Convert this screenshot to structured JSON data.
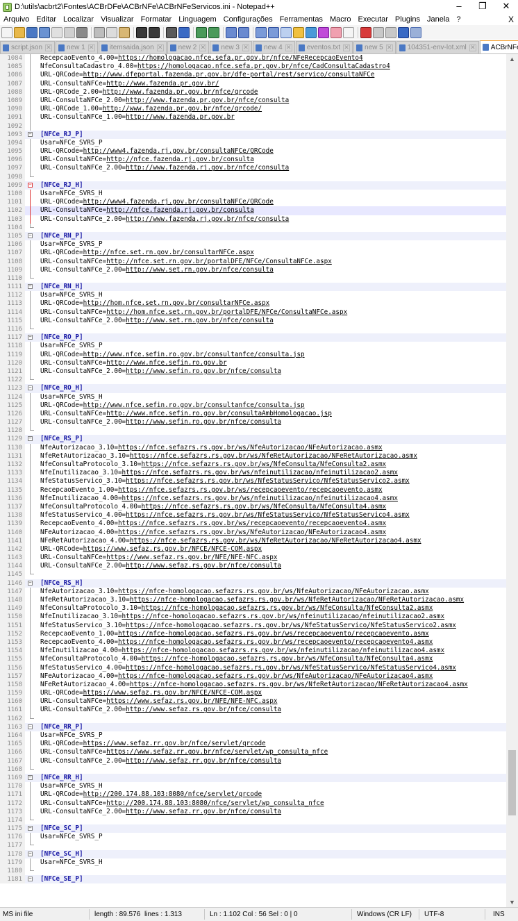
{
  "window": {
    "title": "D:\\utils\\acbrt2\\Fontes\\ACBrDFe\\ACBrNFe\\ACBrNFeServicos.ini - Notepad++",
    "minimize": "–",
    "maximize": "❐",
    "close": "✕"
  },
  "menu": {
    "items": [
      "Arquivo",
      "Editar",
      "Localizar",
      "Visualizar",
      "Formatar",
      "Linguagem",
      "Configurações",
      "Ferramentas",
      "Macro",
      "Executar",
      "Plugins",
      "Janela",
      "?"
    ],
    "close_doc": "X"
  },
  "tabs": [
    {
      "label": "script.json",
      "active": false
    },
    {
      "label": "new 1",
      "active": false
    },
    {
      "label": "itemsaida.json",
      "active": false
    },
    {
      "label": "new 2",
      "active": false
    },
    {
      "label": "new 3",
      "active": false
    },
    {
      "label": "new 4",
      "active": false
    },
    {
      "label": "eventos.txt",
      "active": false
    },
    {
      "label": "new 5",
      "active": false
    },
    {
      "label": "104351-env-lot.xml",
      "active": false
    },
    {
      "label": "ACBrNFeServicos.ini",
      "active": true
    }
  ],
  "editor": {
    "lines": [
      {
        "n": "1084",
        "t": "RecepcaoEvento_4.00=https://homologacao.nfce.sefa.pr.gov.br/nfce/NFeRecepcaoEvento4"
      },
      {
        "n": "1085",
        "t": "NfeConsultaCadastro_4.00=https://homologacao.nfce.sefa.pr.gov.br/nfce/CadConsultaCadastro4"
      },
      {
        "n": "1086",
        "t": "URL-QRCode=http://www.dfeportal.fazenda.pr.gov.br/dfe-portal/rest/servico/consultaNFCe"
      },
      {
        "n": "1087",
        "t": "URL-ConsultaNFCe=http://www.fazenda.pr.gov.br/"
      },
      {
        "n": "1088",
        "t": "URL-QRCode_2.00=http://www.fazenda.pr.gov.br/nfce/qrcode"
      },
      {
        "n": "1089",
        "t": "URL-ConsultaNFCe_2.00=http://www.fazenda.pr.gov.br/nfce/consulta"
      },
      {
        "n": "1090",
        "t": "URL-QRCode_1.00=http://www.fazenda.pr.gov.br/nfce/qrcode/"
      },
      {
        "n": "1091",
        "t": "URL-ConsultaNFCe_1.00=http://www.fazenda.pr.gov.br"
      },
      {
        "n": "1092",
        "t": ""
      },
      {
        "n": "1093",
        "t": "[NFCe_RJ_P]"
      },
      {
        "n": "1094",
        "t": "Usar=NFCe_SVRS_P"
      },
      {
        "n": "1095",
        "t": "URL-QRCode=http://www4.fazenda.rj.gov.br/consultaNFCe/QRCode"
      },
      {
        "n": "1096",
        "t": "URL-ConsultaNFCe=http://nfce.fazenda.rj.gov.br/consulta"
      },
      {
        "n": "1097",
        "t": "URL-ConsultaNFCe_2.00=http://www.fazenda.rj.gov.br/nfce/consulta"
      },
      {
        "n": "1098",
        "t": ""
      },
      {
        "n": "1099",
        "t": "[NFCe_RJ_H]"
      },
      {
        "n": "1100",
        "t": "Usar=NFCe_SVRS_H"
      },
      {
        "n": "1101",
        "t": "URL-QRCode=http://www4.fazenda.rj.gov.br/consultaNFCe/QRCode"
      },
      {
        "n": "1102",
        "t": "URL-ConsultaNFCe=http://nfce.fazenda.rj.gov.br/consulta"
      },
      {
        "n": "1103",
        "t": "URL-ConsultaNFCe_2.00=http://www.fazenda.rj.gov.br/nfce/consulta"
      },
      {
        "n": "1104",
        "t": ""
      },
      {
        "n": "1105",
        "t": "[NFCe_RN_P]"
      },
      {
        "n": "1106",
        "t": "Usar=NFCe_SVRS_P"
      },
      {
        "n": "1107",
        "t": "URL-QRCode=http://nfce.set.rn.gov.br/consultarNFCe.aspx"
      },
      {
        "n": "1108",
        "t": "URL-ConsultaNFCe=http://nfce.set.rn.gov.br/portalDFE/NFCe/ConsultaNFCe.aspx"
      },
      {
        "n": "1109",
        "t": "URL-ConsultaNFCe_2.00=http://www.set.rn.gov.br/nfce/consulta"
      },
      {
        "n": "1110",
        "t": ""
      },
      {
        "n": "1111",
        "t": "[NFCe_RN_H]"
      },
      {
        "n": "1112",
        "t": "Usar=NFCe_SVRS_H"
      },
      {
        "n": "1113",
        "t": "URL-QRCode=http://hom.nfce.set.rn.gov.br/consultarNFCe.aspx"
      },
      {
        "n": "1114",
        "t": "URL-ConsultaNFCe=http://hom.nfce.set.rn.gov.br/portalDFE/NFCe/ConsultaNFCe.aspx"
      },
      {
        "n": "1115",
        "t": "URL-ConsultaNFCe_2.00=http://www.set.rn.gov.br/nfce/consulta"
      },
      {
        "n": "1116",
        "t": ""
      },
      {
        "n": "1117",
        "t": "[NFCe_RO_P]"
      },
      {
        "n": "1118",
        "t": "Usar=NFCe_SVRS_P"
      },
      {
        "n": "1119",
        "t": "URL-QRCode=http://www.nfce.sefin.ro.gov.br/consultanfce/consulta.jsp"
      },
      {
        "n": "1120",
        "t": "URL-ConsultaNFCe=http://www.nfce.sefin.ro.gov.br"
      },
      {
        "n": "1121",
        "t": "URL-ConsultaNFCe_2.00=http://www.sefin.ro.gov.br/nfce/consulta"
      },
      {
        "n": "1122",
        "t": ""
      },
      {
        "n": "1123",
        "t": "[NFCe_RO_H]"
      },
      {
        "n": "1124",
        "t": "Usar=NFCe_SVRS_H"
      },
      {
        "n": "1125",
        "t": "URL-QRCode=http://www.nfce.sefin.ro.gov.br/consultanfce/consulta.jsp"
      },
      {
        "n": "1126",
        "t": "URL-ConsultaNFCe=http://www.nfce.sefin.ro.gov.br/consultaAmbHomologacao.jsp"
      },
      {
        "n": "1127",
        "t": "URL-ConsultaNFCe_2.00=http://www.sefin.ro.gov.br/nfce/consulta"
      },
      {
        "n": "1128",
        "t": ""
      },
      {
        "n": "1129",
        "t": "[NFCe_RS_P]"
      },
      {
        "n": "1130",
        "t": "NfeAutorizacao_3.10=https://nfce.sefazrs.rs.gov.br/ws/NfeAutorizacao/NFeAutorizacao.asmx"
      },
      {
        "n": "1131",
        "t": "NfeRetAutorizacao_3.10=https://nfce.sefazrs.rs.gov.br/ws/NfeRetAutorizacao/NFeRetAutorizacao.asmx"
      },
      {
        "n": "1132",
        "t": "NfeConsultaProtocolo_3.10=https://nfce.sefazrs.rs.gov.br/ws/NfeConsulta/NfeConsulta2.asmx"
      },
      {
        "n": "1133",
        "t": "NfeInutilizacao_3.10=https://nfce.sefazrs.rs.gov.br/ws/nfeinutilizacao/nfeinutilizacao2.asmx"
      },
      {
        "n": "1134",
        "t": "NfeStatusServico_3.10=https://nfce.sefazrs.rs.gov.br/ws/NfeStatusServico/NfeStatusServico2.asmx"
      },
      {
        "n": "1135",
        "t": "RecepcaoEvento_1.00=https://nfce.sefazrs.rs.gov.br/ws/recepcaoevento/recepcaoevento.asmx"
      },
      {
        "n": "1136",
        "t": "NfeInutilizacao_4.00=https://nfce.sefazrs.rs.gov.br/ws/nfeinutilizacao/nfeinutilizacao4.asmx"
      },
      {
        "n": "1137",
        "t": "NfeConsultaProtocolo_4.00=https://nfce.sefazrs.rs.gov.br/ws/NfeConsulta/NfeConsulta4.asmx"
      },
      {
        "n": "1138",
        "t": "NfeStatusServico_4.00=https://nfce.sefazrs.rs.gov.br/ws/NfeStatusServico/NfeStatusServico4.asmx"
      },
      {
        "n": "1139",
        "t": "RecepcaoEvento_4.00=https://nfce.sefazrs.rs.gov.br/ws/recepcaoevento/recepcaoevento4.asmx"
      },
      {
        "n": "1140",
        "t": "NFeAutorizacao_4.00=https://nfce.sefazrs.rs.gov.br/ws/NfeAutorizacao/NFeAutorizacao4.asmx"
      },
      {
        "n": "1141",
        "t": "NFeRetAutorizacao_4.00=https://nfce.sefazrs.rs.gov.br/ws/NfeRetAutorizacao/NFeRetAutorizacao4.asmx"
      },
      {
        "n": "1142",
        "t": "URL-QRCode=https://www.sefaz.rs.gov.br/NFCE/NFCE-COM.aspx"
      },
      {
        "n": "1143",
        "t": "URL-ConsultaNFCe=https://www.sefaz.rs.gov.br/NFE/NFE-NFC.aspx"
      },
      {
        "n": "1144",
        "t": "URL-ConsultaNFCe_2.00=http://www.sefaz.rs.gov.br/nfce/consulta"
      },
      {
        "n": "1145",
        "t": ""
      },
      {
        "n": "1146",
        "t": "[NFCe_RS_H]"
      },
      {
        "n": "1147",
        "t": "NfeAutorizacao_3.10=https://nfce-homologacao.sefazrs.rs.gov.br/ws/NfeAutorizacao/NFeAutorizacao.asmx"
      },
      {
        "n": "1148",
        "t": "NfeRetAutorizacao_3.10=https://nfce-homologacao.sefazrs.rs.gov.br/ws/NfeRetAutorizacao/NFeRetAutorizacao.asmx"
      },
      {
        "n": "1149",
        "t": "NfeConsultaProtocolo_3.10=https://nfce-homologacao.sefazrs.rs.gov.br/ws/NfeConsulta/NfeConsulta2.asmx"
      },
      {
        "n": "1150",
        "t": "NfeInutilizacao_3.10=https://nfce-homologacao.sefazrs.rs.gov.br/ws/nfeinutilizacao/nfeinutilizacao2.asmx"
      },
      {
        "n": "1151",
        "t": "NfeStatusServico_3.10=https://nfce-homologacao.sefazrs.rs.gov.br/ws/NfeStatusServico/NfeStatusServico2.asmx"
      },
      {
        "n": "1152",
        "t": "RecepcaoEvento_1.00=https://nfce-homologacao.sefazrs.rs.gov.br/ws/recepcaoevento/recepcaoevento.asmx"
      },
      {
        "n": "1153",
        "t": "RecepcaoEvento_4.00=https://nfce-homologacao.sefazrs.rs.gov.br/ws/recepcaoevento/recepcaoevento4.asmx"
      },
      {
        "n": "1154",
        "t": "NfeInutilizacao_4.00=https://nfce-homologacao.sefazrs.rs.gov.br/ws/nfeinutilizacao/nfeinutilizacao4.asmx"
      },
      {
        "n": "1155",
        "t": "NfeConsultaProtocolo_4.00=https://nfce-homologacao.sefazrs.rs.gov.br/ws/NfeConsulta/NfeConsulta4.asmx"
      },
      {
        "n": "1156",
        "t": "NfeStatusServico_4.00=https://nfce-homologacao.sefazrs.rs.gov.br/ws/NfeStatusServico/NfeStatusServico4.asmx"
      },
      {
        "n": "1157",
        "t": "NFeAutorizacao_4.00=https://nfce-homologacao.sefazrs.rs.gov.br/ws/NfeAutorizacao/NFeAutorizacao4.asmx"
      },
      {
        "n": "1158",
        "t": "NFeRetAutorizacao_4.00=https://nfce-homologacao.sefazrs.rs.gov.br/ws/NfeRetAutorizacao/NFeRetAutorizacao4.asmx"
      },
      {
        "n": "1159",
        "t": "URL-QRCode=https://www.sefaz.rs.gov.br/NFCE/NFCE-COM.aspx"
      },
      {
        "n": "1160",
        "t": "URL-ConsultaNFCe=https://www.sefaz.rs.gov.br/NFE/NFE-NFC.aspx"
      },
      {
        "n": "1161",
        "t": "URL-ConsultaNFCe_2.00=http://www.sefaz.rs.gov.br/nfce/consulta"
      },
      {
        "n": "1162",
        "t": ""
      },
      {
        "n": "1163",
        "t": "[NFCe_RR_P]"
      },
      {
        "n": "1164",
        "t": "Usar=NFCe_SVRS_P"
      },
      {
        "n": "1165",
        "t": "URL-QRCode=https://www.sefaz.rr.gov.br/nfce/servlet/qrcode"
      },
      {
        "n": "1166",
        "t": "URL-ConsultaNFCe=https://www.sefaz.rr.gov.br/nfce/servlet/wp_consulta_nfce"
      },
      {
        "n": "1167",
        "t": "URL-ConsultaNFCe_2.00=http://www.sefaz.rr.gov.br/nfce/consulta"
      },
      {
        "n": "1168",
        "t": ""
      },
      {
        "n": "1169",
        "t": "[NFCe_RR_H]"
      },
      {
        "n": "1170",
        "t": "Usar=NFCe_SVRS_H"
      },
      {
        "n": "1171",
        "t": "URL-QRCode=http://200.174.88.103:8080/nfce/servlet/qrcode"
      },
      {
        "n": "1172",
        "t": "URL-ConsultaNFCe=http://200.174.88.103:8080/nfce/servlet/wp_consulta_nfce"
      },
      {
        "n": "1173",
        "t": "URL-ConsultaNFCe_2.00=http://www.sefaz.rr.gov.br/nfce/consulta"
      },
      {
        "n": "1174",
        "t": ""
      },
      {
        "n": "1175",
        "t": "[NFCe_SC_P]"
      },
      {
        "n": "1176",
        "t": "Usar=NFCe_SVRS_P"
      },
      {
        "n": "1177",
        "t": ""
      },
      {
        "n": "1178",
        "t": "[NFCe_SC_H]"
      },
      {
        "n": "1179",
        "t": "Usar=NFCe_SVRS_H"
      },
      {
        "n": "1180",
        "t": ""
      },
      {
        "n": "1181",
        "t": "[NFCe_SE_P]"
      }
    ]
  },
  "status": {
    "file_type": "MS ini file",
    "length": "length : 89.576",
    "lines": "lines : 1.313",
    "position": "Ln : 1.102   Col : 56   Sel : 0 | 0",
    "eol": "Windows (CR LF)",
    "encoding": "UTF-8",
    "mode": "INS"
  }
}
